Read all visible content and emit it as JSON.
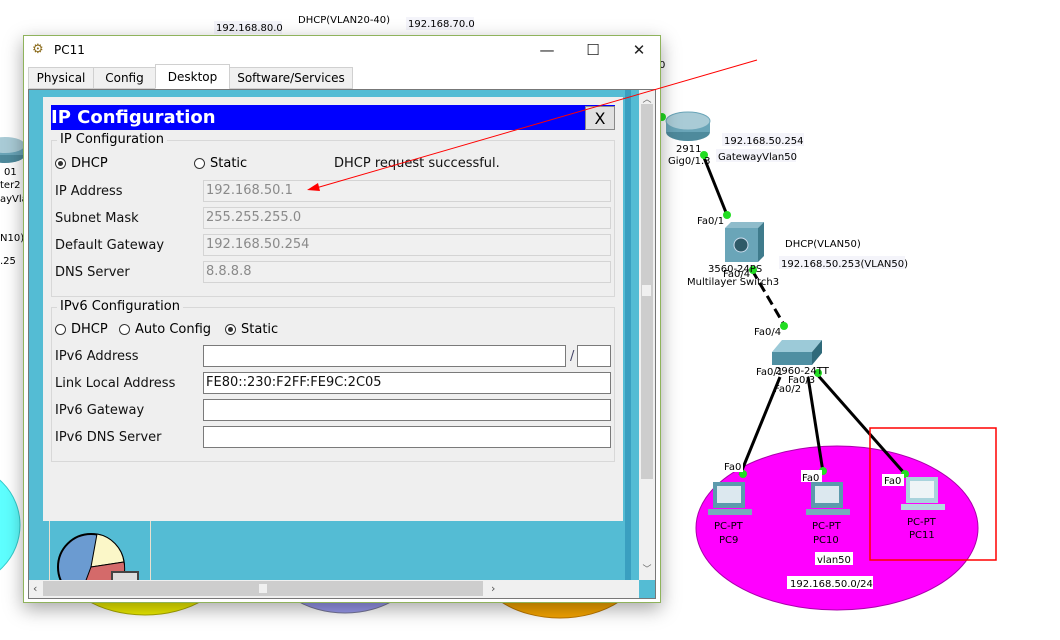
{
  "topology": {
    "top_labels": [
      "192.168.80.0",
      "DHCP(VLAN20-40)",
      "192.168.70.0"
    ],
    "left_fragments": [
      "01",
      "ter2",
      "ayVla",
      "N10)",
      ".25"
    ],
    "right_edge_fragment": "0",
    "router": {
      "model": "2911",
      "port": "Gig0/1.3",
      "ip": "192.168.50.254",
      "desc": "GatewayVlan50"
    },
    "multilayer_switch": {
      "model": "3560-24PS",
      "name": "Multilayer Switch3",
      "port_up": "Fa0/1",
      "port_down": "Fa0/4",
      "dhcp": "DHCP(VLAN50)",
      "ip": "192.168.50.253(VLAN50)"
    },
    "switch": {
      "model": "2960-24TT",
      "port_up": "Fa0/4",
      "ports": [
        "Fa0/1",
        "Fa0/2",
        "Fa0/3"
      ]
    },
    "pcs": [
      {
        "type": "PC-PT",
        "name": "PC9",
        "port": "Fa0"
      },
      {
        "type": "PC-PT",
        "name": "PC10",
        "port": "Fa0"
      },
      {
        "type": "PC-PT",
        "name": "PC11",
        "port": "Fa0"
      }
    ],
    "vlan_label": "vlan50",
    "network_label": "192.168.50.0/24",
    "colors": {
      "vlan_area": "#ff00ff",
      "link_up": "#22dd22",
      "annotation": "#ff0000"
    }
  },
  "window": {
    "title": "PC11",
    "tabs": [
      "Physical",
      "Config",
      "Desktop",
      "Software/Services"
    ],
    "active_tab": "Desktop",
    "controls": {
      "minimize": "—",
      "maximize": "☐",
      "close": "✕"
    }
  },
  "ip_config": {
    "title": "IP Configuration",
    "close_label": "X",
    "ipv4": {
      "legend": "IP Configuration",
      "mode_dhcp": "DHCP",
      "mode_static": "Static",
      "selected": "DHCP",
      "status": "DHCP request successful.",
      "fields": [
        {
          "label": "IP Address",
          "value": "192.168.50.1"
        },
        {
          "label": "Subnet Mask",
          "value": "255.255.255.0"
        },
        {
          "label": "Default Gateway",
          "value": "192.168.50.254"
        },
        {
          "label": "DNS Server",
          "value": "8.8.8.8"
        }
      ]
    },
    "ipv6": {
      "legend": "IPv6 Configuration",
      "modes": [
        "DHCP",
        "Auto Config",
        "Static"
      ],
      "selected": "Static",
      "address_label": "IPv6 Address",
      "address_value": "",
      "prefix_separator": "/",
      "prefix_value": "",
      "link_local_label": "Link Local Address",
      "link_local_value": "FE80::230:F2FF:FE9C:2C05",
      "gateway_label": "IPv6 Gateway",
      "gateway_value": "",
      "dns_label": "IPv6 DNS Server",
      "dns_value": ""
    }
  }
}
